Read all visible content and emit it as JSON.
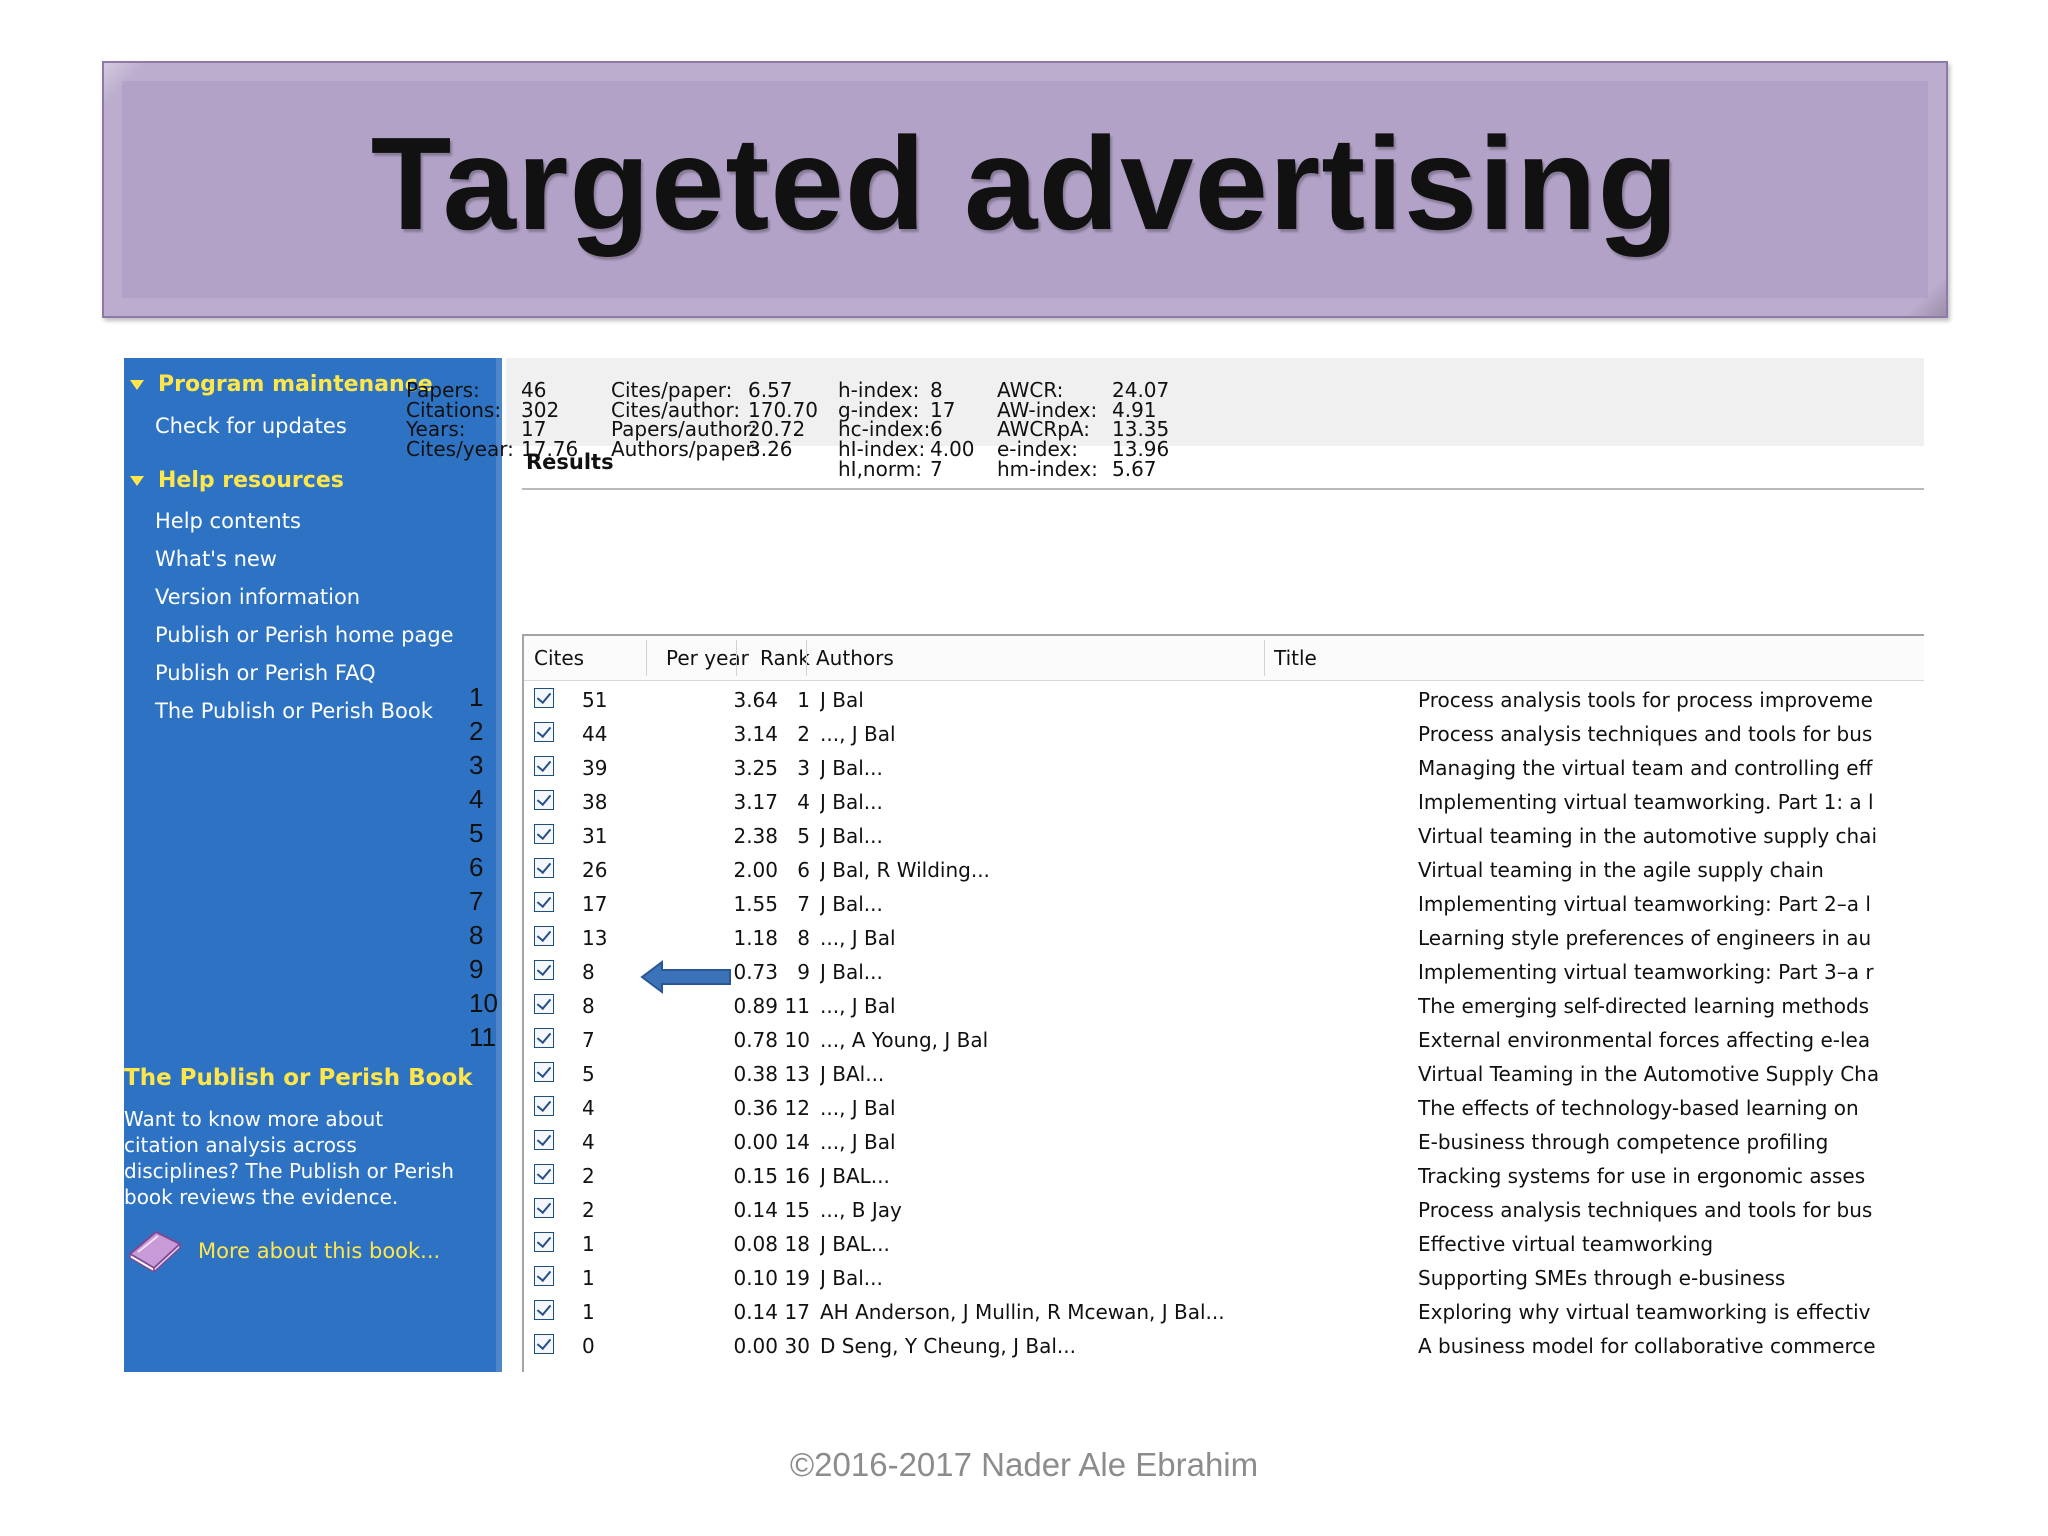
{
  "slide": {
    "title": "Targeted advertising",
    "footer": "©2016-2017  Nader Ale Ebrahim"
  },
  "sidebar": {
    "sections": [
      {
        "heading": "Program maintenance",
        "links": [
          "Check for updates"
        ]
      },
      {
        "heading": "Help resources",
        "links": [
          "Help contents",
          "What's new",
          "Version information",
          "Publish or Perish home page",
          "Publish or Perish FAQ",
          "The Publish or Perish Book"
        ]
      }
    ],
    "book_heading": "The Publish or Perish Book",
    "book_blurb": "Want to know more about citation analysis across disciplines? The Publish or Perish book reviews the evidence.",
    "book_link": "More about this book..."
  },
  "row_numbers": [
    "1",
    "2",
    "3",
    "4",
    "5",
    "6",
    "7",
    "8",
    "9",
    "10",
    "11"
  ],
  "results": {
    "label": "Results",
    "metrics": [
      {
        "label": "Papers:",
        "value": "46"
      },
      {
        "label": "Citations:",
        "value": "302"
      },
      {
        "label": "Years:",
        "value": "17"
      },
      {
        "label": "Cites/year:",
        "value": "17.76"
      },
      {
        "label": "Cites/paper:",
        "value": "6.57"
      },
      {
        "label": "Cites/author:",
        "value": "170.70"
      },
      {
        "label": "Papers/author:",
        "value": "20.72"
      },
      {
        "label": "Authors/paper:",
        "value": "3.26"
      },
      {
        "label": "h-index:",
        "value": "8"
      },
      {
        "label": "g-index:",
        "value": "17"
      },
      {
        "label": "hc-index:",
        "value": "6"
      },
      {
        "label": "hI-index:",
        "value": "4.00"
      },
      {
        "label": "hI,norm:",
        "value": "7"
      },
      {
        "label": "AWCR:",
        "value": "24.07"
      },
      {
        "label": "AW-index:",
        "value": "4.91"
      },
      {
        "label": "AWCRpA:",
        "value": "13.35"
      },
      {
        "label": "e-index:",
        "value": "13.96"
      },
      {
        "label": "hm-index:",
        "value": "5.67"
      }
    ],
    "columns": [
      "Cites",
      "Per year",
      "Rank",
      "Authors",
      "Title"
    ],
    "rows": [
      {
        "cites": "51",
        "per_year": "3.64",
        "rank": "1",
        "authors": "J Bal",
        "title": "Process analysis tools for process improveme"
      },
      {
        "cites": "44",
        "per_year": "3.14",
        "rank": "2",
        "authors": "..., J Bal",
        "title": "Process analysis techniques and tools for bus"
      },
      {
        "cites": "39",
        "per_year": "3.25",
        "rank": "3",
        "authors": "J Bal...",
        "title": "Managing the virtual team and controlling eff"
      },
      {
        "cites": "38",
        "per_year": "3.17",
        "rank": "4",
        "authors": "J Bal...",
        "title": "Implementing virtual teamworking. Part 1: a l"
      },
      {
        "cites": "31",
        "per_year": "2.38",
        "rank": "5",
        "authors": "J Bal...",
        "title": "Virtual teaming in the automotive supply chai"
      },
      {
        "cites": "26",
        "per_year": "2.00",
        "rank": "6",
        "authors": "J Bal, R Wilding...",
        "title": "Virtual teaming in the agile supply chain"
      },
      {
        "cites": "17",
        "per_year": "1.55",
        "rank": "7",
        "authors": "J Bal...",
        "title": "Implementing virtual teamworking: Part 2–a l"
      },
      {
        "cites": "13",
        "per_year": "1.18",
        "rank": "8",
        "authors": "..., J Bal",
        "title": "Learning style preferences of engineers in au"
      },
      {
        "cites": "8",
        "per_year": "0.73",
        "rank": "9",
        "authors": "J Bal...",
        "title": "Implementing virtual teamworking: Part 3–a r"
      },
      {
        "cites": "8",
        "per_year": "0.89",
        "rank": "11",
        "authors": "..., J Bal",
        "title": "The emerging self-directed learning methods"
      },
      {
        "cites": "7",
        "per_year": "0.78",
        "rank": "10",
        "authors": "..., A Young, J Bal",
        "title": "External environmental forces affecting e-lea"
      },
      {
        "cites": "5",
        "per_year": "0.38",
        "rank": "13",
        "authors": "J BAl...",
        "title": "Virtual Teaming in the Automotive Supply Cha"
      },
      {
        "cites": "4",
        "per_year": "0.36",
        "rank": "12",
        "authors": "..., J Bal",
        "title": "The effects of technology-based learning on"
      },
      {
        "cites": "4",
        "per_year": "0.00",
        "rank": "14",
        "authors": "..., J Bal",
        "title": "E-business through competence profiling"
      },
      {
        "cites": "2",
        "per_year": "0.15",
        "rank": "16",
        "authors": "J BAL...",
        "title": "Tracking systems for use in ergonomic asses"
      },
      {
        "cites": "2",
        "per_year": "0.14",
        "rank": "15",
        "authors": "..., B Jay",
        "title": "Process analysis techniques and tools for bus"
      },
      {
        "cites": "1",
        "per_year": "0.08",
        "rank": "18",
        "authors": "J BAL...",
        "title": "Effective virtual teamworking"
      },
      {
        "cites": "1",
        "per_year": "0.10",
        "rank": "19",
        "authors": "J Bal...",
        "title": "Supporting SMEs through e-business"
      },
      {
        "cites": "1",
        "per_year": "0.14",
        "rank": "17",
        "authors": "AH Anderson, J Mullin, R Mcewan, J Bal...",
        "title": "Exploring why virtual teamworking is effectiv"
      },
      {
        "cites": "0",
        "per_year": "0.00",
        "rank": "30",
        "authors": "D Seng, Y Cheung, J Bal...",
        "title": "A business model for collaborative commerce"
      }
    ]
  },
  "colors": {
    "sidebar_bg": "#2e73c3",
    "sidebar_heading": "#ffe64a",
    "title_bar": "#b3a2c8",
    "arrow": "#3c72b8"
  },
  "icons": {
    "book": "book-icon",
    "arrow": "left-arrow-icon"
  }
}
